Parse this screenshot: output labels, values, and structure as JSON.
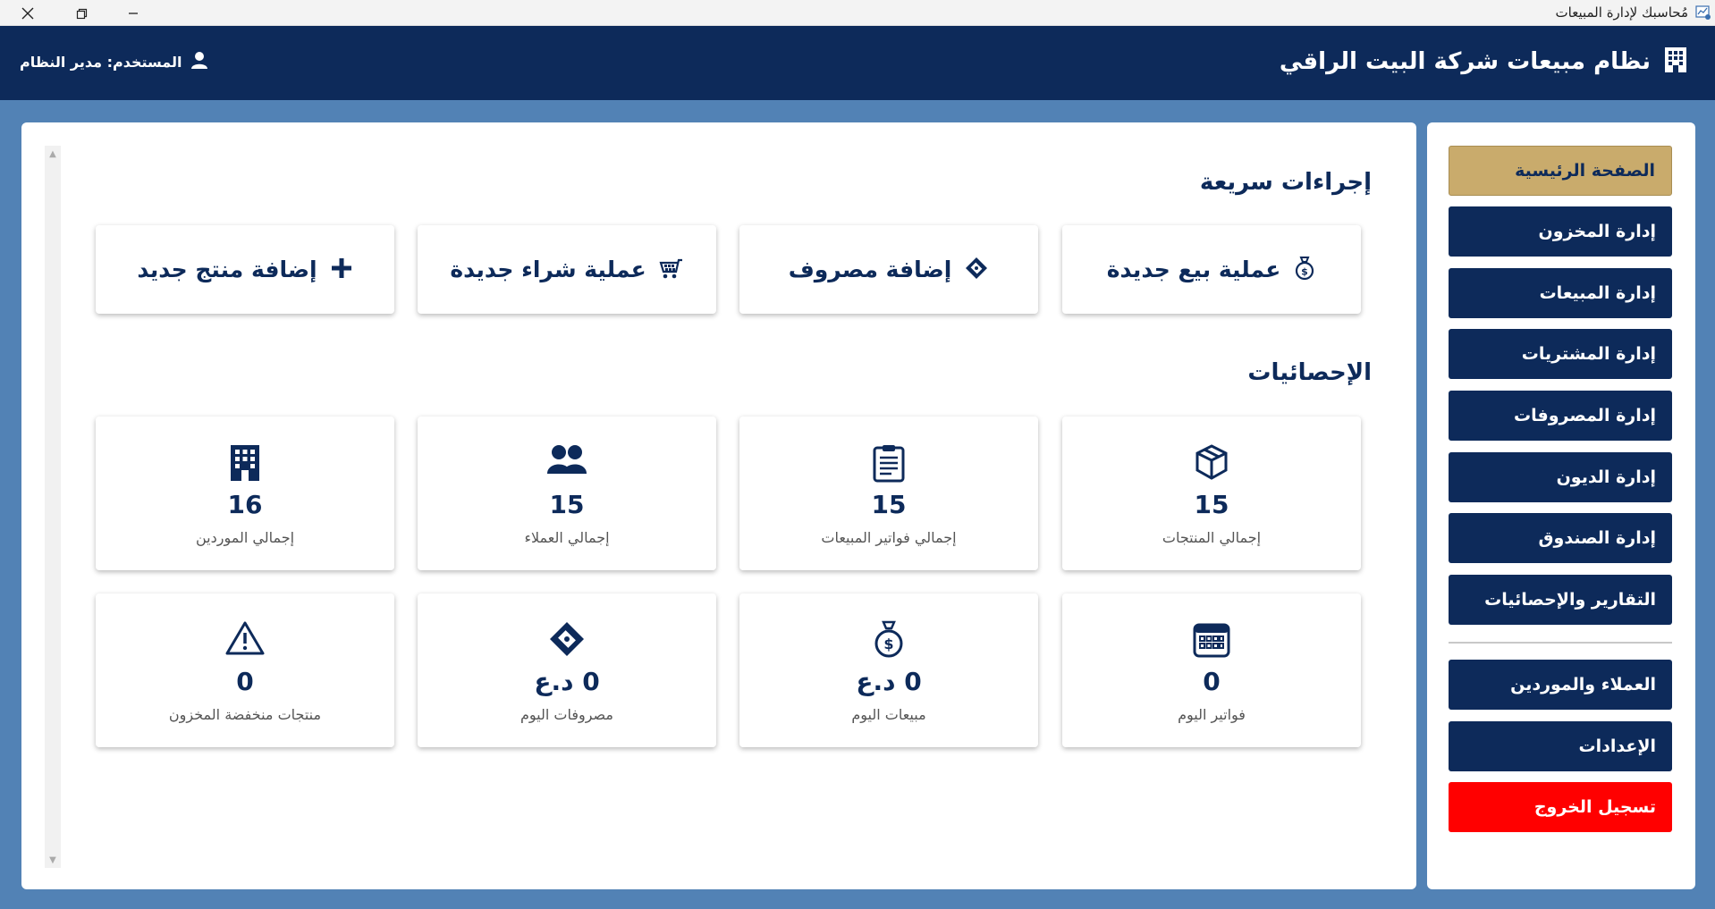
{
  "window": {
    "title": "مُحاسبك لإدارة المبيعات",
    "controls": [
      "close-icon",
      "restore-icon",
      "minimize-icon"
    ]
  },
  "header": {
    "brand_title": "نظام مبيعات شركة البيت الراقي",
    "brand_icon": "building-icon",
    "user_label": "المستخدم: مدير النظام",
    "user_icon": "user-icon"
  },
  "quick_actions": {
    "title": "إجراءات سريعة",
    "items": [
      {
        "label": "عملية بيع جديدة",
        "icon": "money-bag-icon"
      },
      {
        "label": "إضافة مصروف",
        "icon": "money-tag-icon"
      },
      {
        "label": "عملية شراء جديدة",
        "icon": "cart-icon"
      },
      {
        "label": "إضافة منتج جديد",
        "icon": "plus-icon"
      }
    ]
  },
  "statistics": {
    "title": "الإحصائيات",
    "items": [
      {
        "value": "15",
        "caption": "إجمالي المنتجات",
        "icon": "box-icon"
      },
      {
        "value": "15",
        "caption": "إجمالي فواتير المبيعات",
        "icon": "clipboard-icon"
      },
      {
        "value": "15",
        "caption": "إجمالي العملاء",
        "icon": "users-icon"
      },
      {
        "value": "16",
        "caption": "إجمالي الموردين",
        "icon": "building-icon"
      },
      {
        "value": "0",
        "caption": "فواتير اليوم",
        "icon": "calendar-icon"
      },
      {
        "value": "0 د.ع",
        "caption": "مبيعات اليوم",
        "icon": "money-bag-icon"
      },
      {
        "value": "0 د.ع",
        "caption": "مصروفات اليوم",
        "icon": "money-tag-icon"
      },
      {
        "value": "0",
        "caption": "منتجات منخفضة المخزون",
        "icon": "warning-icon"
      }
    ]
  },
  "sidebar": {
    "items": [
      {
        "label": "الصفحة الرئيسية",
        "active": true
      },
      {
        "label": "إدارة المخزون"
      },
      {
        "label": "إدارة المبيعات"
      },
      {
        "label": "إدارة المشتريات"
      },
      {
        "label": "إدارة المصروفات"
      },
      {
        "label": "إدارة الديون"
      },
      {
        "label": "إدارة الصندوق"
      },
      {
        "label": "التقارير والإحصائيات"
      },
      {
        "label": "العملاء والموردين"
      },
      {
        "label": "الإعدادات"
      },
      {
        "label": "تسجيل الخروج"
      }
    ]
  },
  "colors": {
    "navy": "#0d2a5a",
    "background": "#5282b5",
    "active_gold": "#c9ab6c",
    "logout_red": "#ff0000"
  }
}
